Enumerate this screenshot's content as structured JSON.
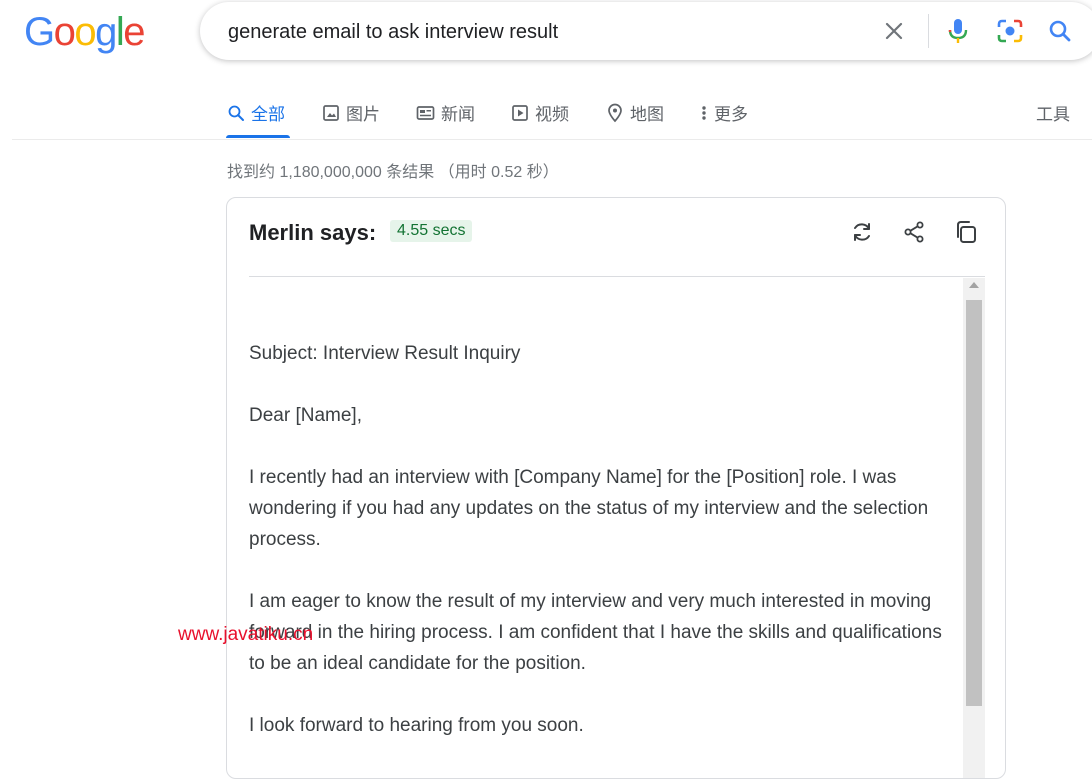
{
  "logo": {
    "letters": [
      "G",
      "o",
      "o",
      "g",
      "l",
      "e"
    ],
    "colors": [
      "#4285f4",
      "#ea4335",
      "#fbbc05",
      "#4285f4",
      "#34a853",
      "#ea4335"
    ]
  },
  "search": {
    "query": "generate email to ask interview result",
    "icons": [
      "close-icon",
      "microphone-icon",
      "camera-lens-icon",
      "search-icon"
    ]
  },
  "tabs": [
    {
      "label": "全部",
      "icon": "search-icon",
      "active": true
    },
    {
      "label": "图片",
      "icon": "image-icon"
    },
    {
      "label": "新闻",
      "icon": "news-icon"
    },
    {
      "label": "视频",
      "icon": "video-icon"
    },
    {
      "label": "地图",
      "icon": "map-pin-icon"
    },
    {
      "label": "更多",
      "icon": "more-dots-icon"
    }
  ],
  "tools_label": "工具",
  "stats": "找到约 1,180,000,000 条结果 （用时 0.52 秒）",
  "merlin": {
    "title": "Merlin says:",
    "time": "4.55 secs",
    "actions": [
      "refresh-icon",
      "share-icon",
      "copy-icon"
    ],
    "paragraphs": [
      "Subject: Interview Result Inquiry",
      "Dear [Name],",
      "I recently had an interview with [Company Name] for the [Position] role. I was wondering if you had any updates on the status of my interview and the selection process.",
      "I am eager to know the result of my interview and very much interested in moving forward in the hiring process. I am confident that I have the skills and qualifications to be an ideal candidate for the position.",
      "I look forward to hearing from you soon."
    ]
  },
  "watermark": "www.javatiku.cn",
  "colors": {
    "accent": "#1a73e8",
    "badge_bg": "#e6f4ea",
    "badge_text": "#137333",
    "watermark": "#e8112d"
  }
}
